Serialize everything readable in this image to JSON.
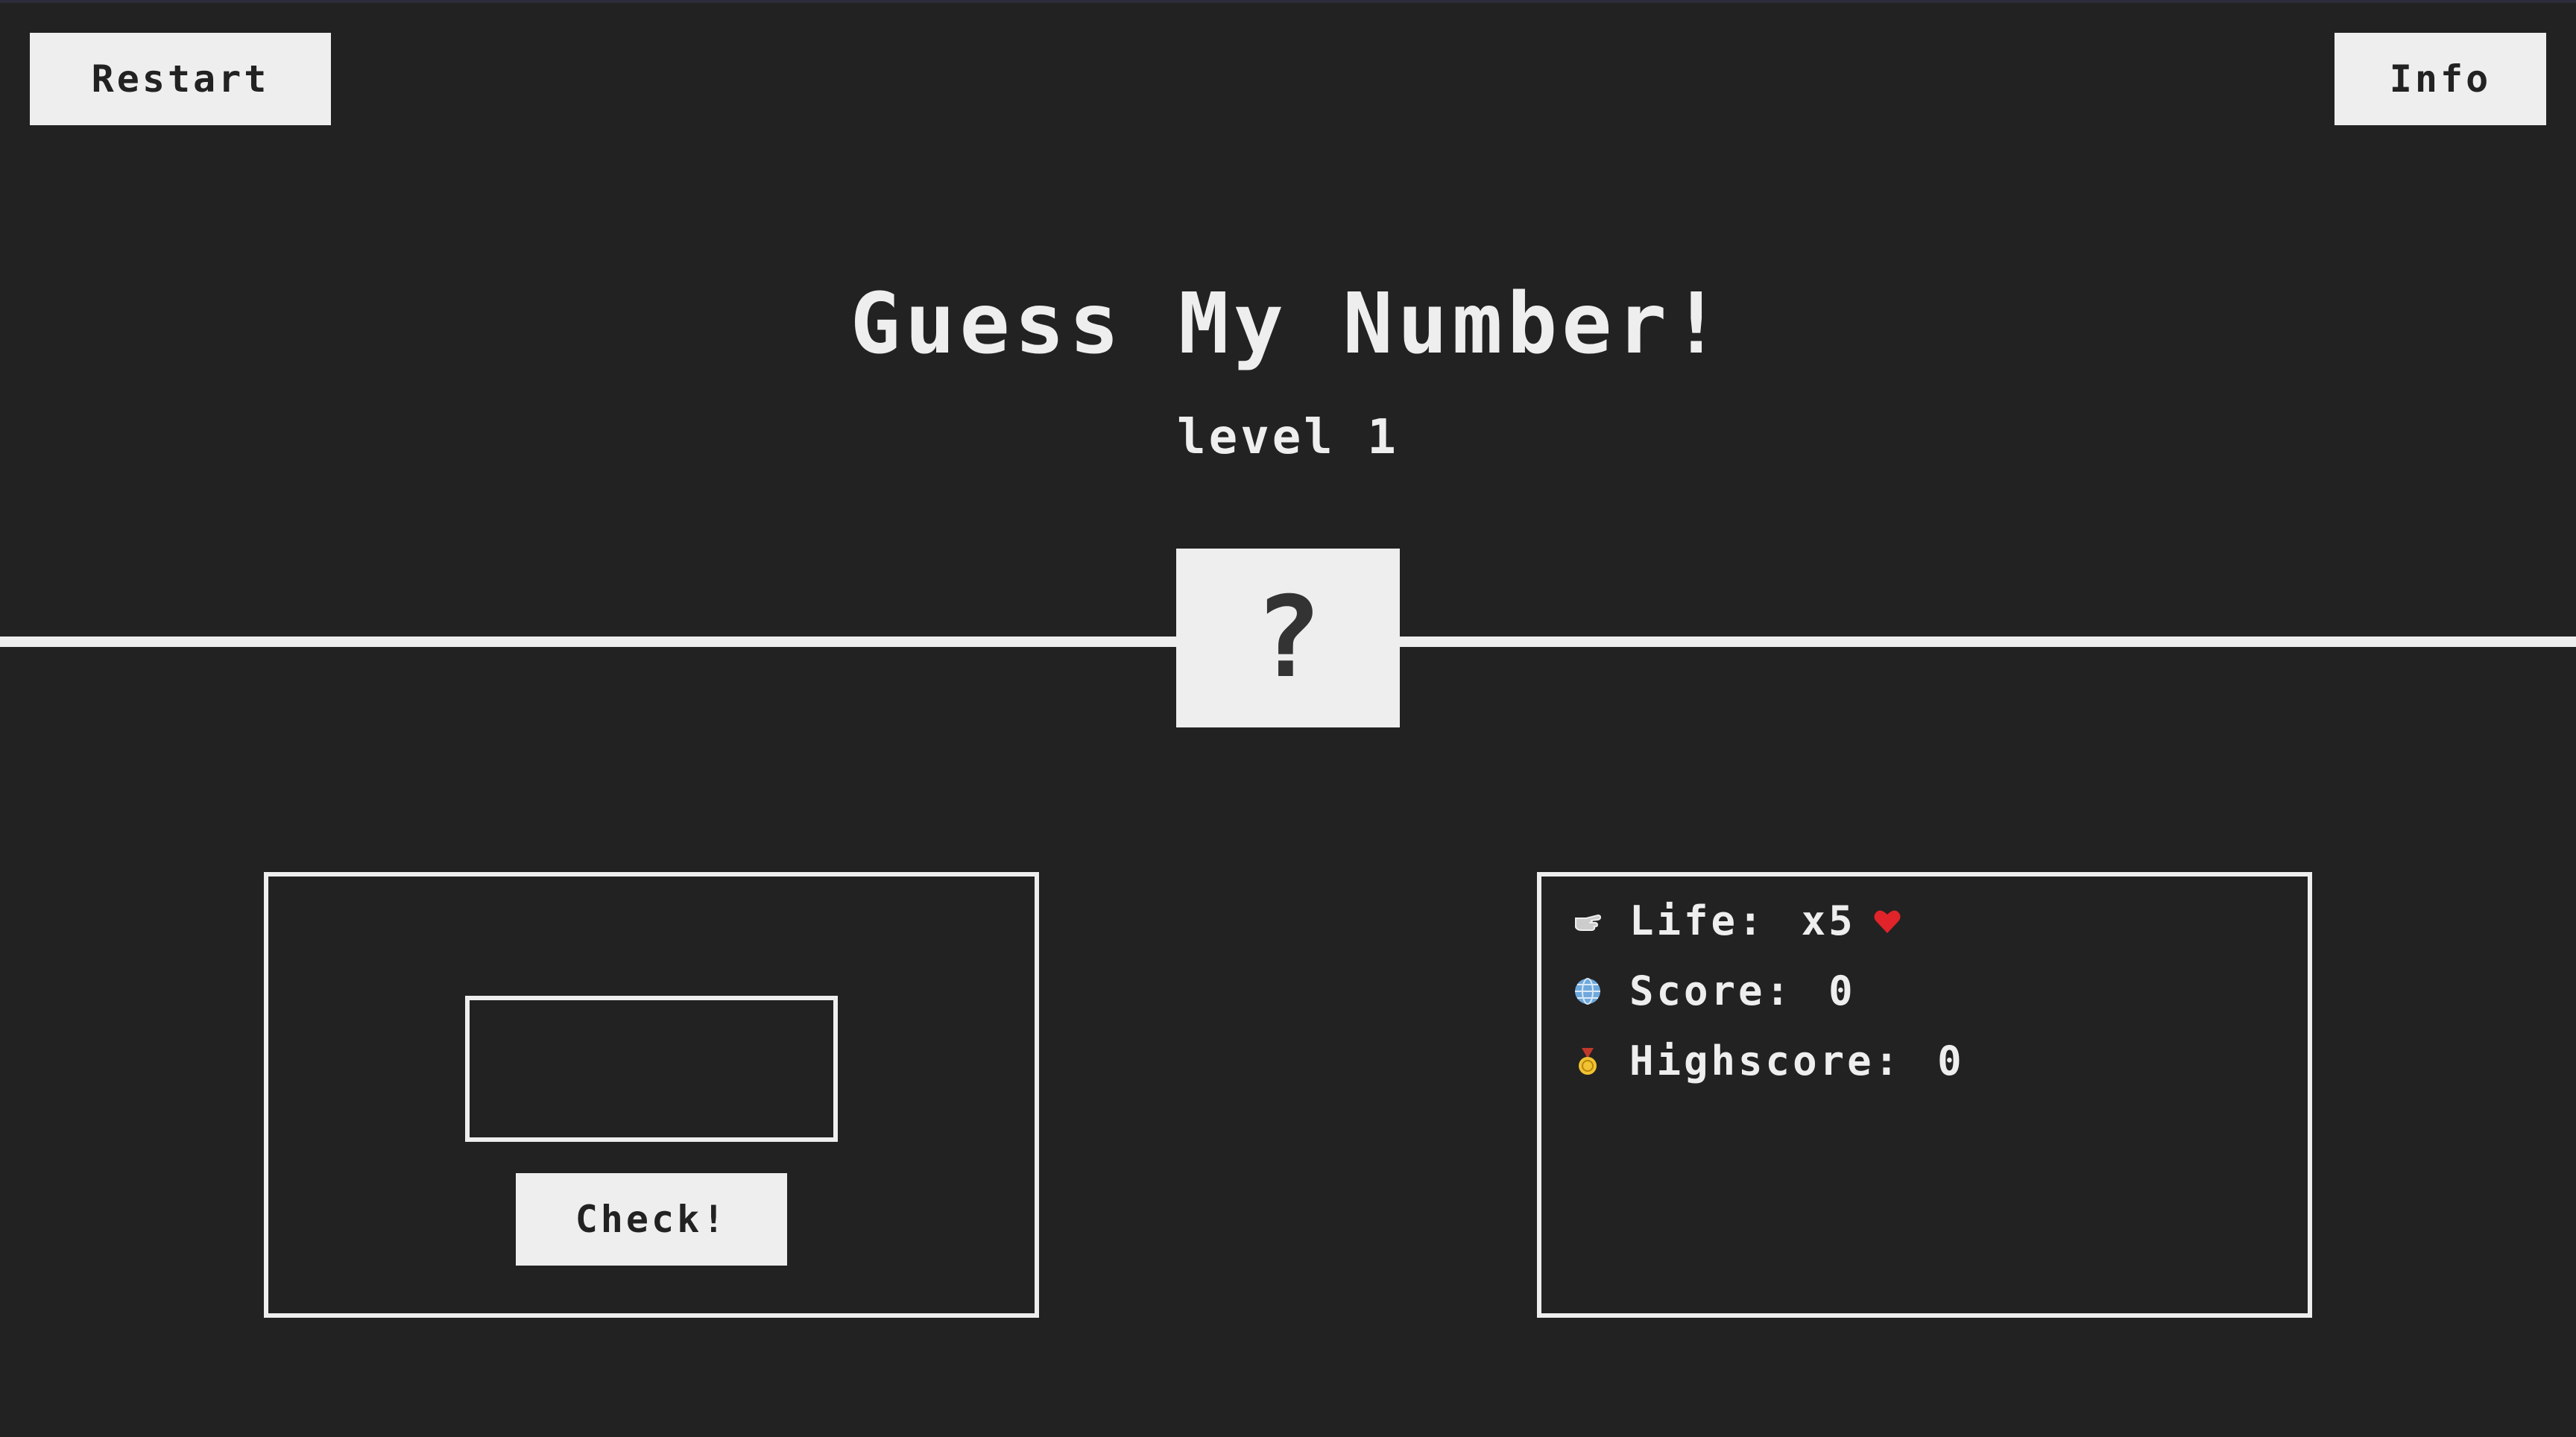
{
  "header": {
    "restart_label": "Restart",
    "info_label": "Info"
  },
  "game": {
    "title": "Guess My Number!",
    "level": "level 1",
    "secret_display": "?"
  },
  "guess": {
    "input_value": "",
    "check_label": "Check!"
  },
  "stats": {
    "life_label": "Life:",
    "life_value": "x5",
    "score_label": "Score:",
    "score_value": "0",
    "highscore_label": "Highscore:",
    "highscore_value": "0",
    "icons": [
      "pointing-hand-icon",
      "globe-icon",
      "medal-icon",
      "heart-icon"
    ]
  },
  "colors": {
    "background": "#222222",
    "foreground": "#eeeeee",
    "heart": "#e0242a"
  }
}
